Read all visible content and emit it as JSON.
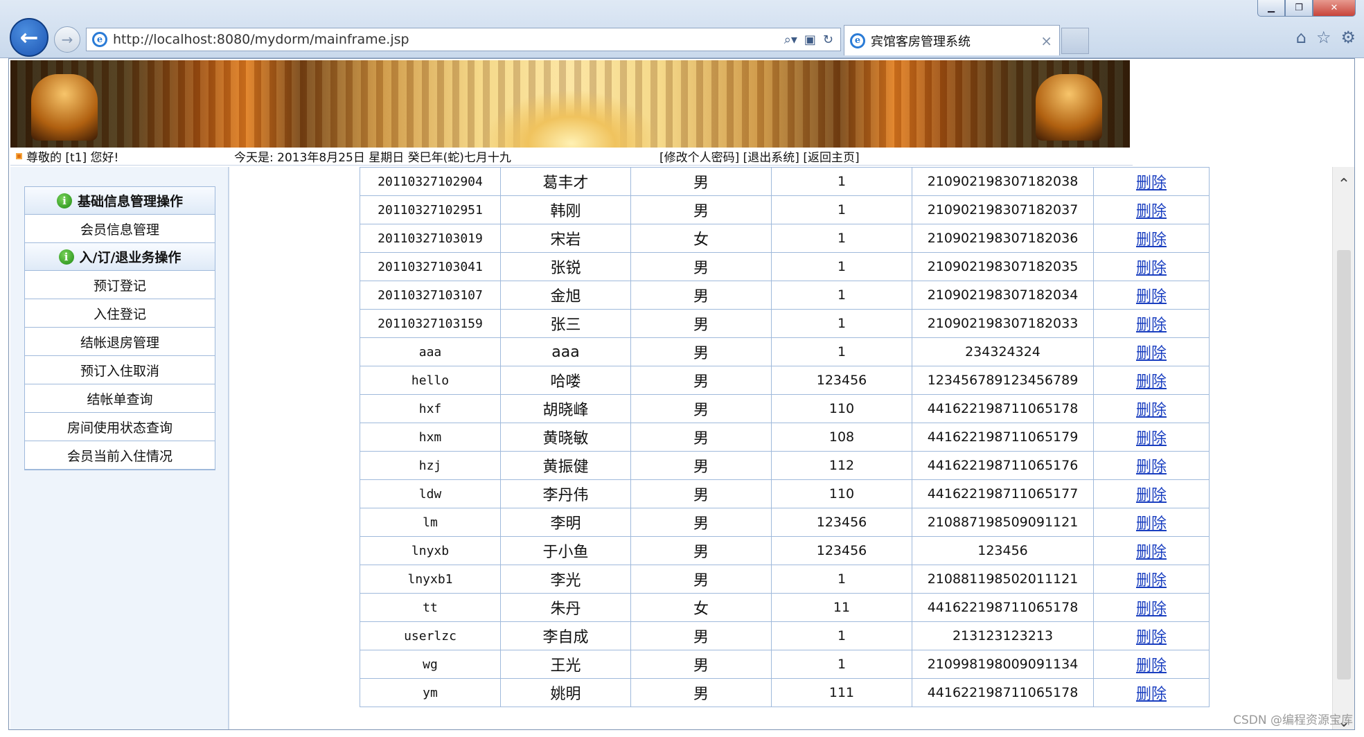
{
  "browser": {
    "url": "http://localhost:8080/mydorm/mainframe.jsp",
    "tab_title": "宾馆客房管理系统",
    "tab_close": "×"
  },
  "greeting": {
    "welcome": "尊敬的 [t1] 您好!",
    "date": "今天是:  2013年8月25日  星期日  癸巳年(蛇)七月十九",
    "links": "[修改个人密码] [退出系统] [返回主页]"
  },
  "sidebar": {
    "section1": "基础信息管理操作",
    "section1_items": [
      "会员信息管理"
    ],
    "section2": "入/订/退业务操作",
    "section2_items": [
      "预订登记",
      "入住登记",
      "结帐退房管理",
      "预订入住取消",
      "结帐单查询",
      "房间使用状态查询",
      "会员当前入住情况"
    ]
  },
  "table": {
    "delete_label": "删除",
    "rows": [
      [
        "20110327102904",
        "葛丰才",
        "男",
        "1",
        "210902198307182038"
      ],
      [
        "20110327102951",
        "韩刚",
        "男",
        "1",
        "210902198307182037"
      ],
      [
        "20110327103019",
        "宋岩",
        "女",
        "1",
        "210902198307182036"
      ],
      [
        "20110327103041",
        "张锐",
        "男",
        "1",
        "210902198307182035"
      ],
      [
        "20110327103107",
        "金旭",
        "男",
        "1",
        "210902198307182034"
      ],
      [
        "20110327103159",
        "张三",
        "男",
        "1",
        "210902198307182033"
      ],
      [
        "aaa",
        "aaa",
        "男",
        "1",
        "234324324"
      ],
      [
        "hello",
        "哈喽",
        "男",
        "123456",
        "123456789123456789"
      ],
      [
        "hxf",
        "胡晓峰",
        "男",
        "110",
        "441622198711065178"
      ],
      [
        "hxm",
        "黄晓敏",
        "男",
        "108",
        "441622198711065179"
      ],
      [
        "hzj",
        "黄振健",
        "男",
        "112",
        "441622198711065176"
      ],
      [
        "ldw",
        "李丹伟",
        "男",
        "110",
        "441622198711065177"
      ],
      [
        "lm",
        "李明",
        "男",
        "123456",
        "210887198509091121"
      ],
      [
        "lnyxb",
        "于小鱼",
        "男",
        "123456",
        "123456"
      ],
      [
        "lnyxb1",
        "李光",
        "男",
        "1",
        "210881198502011121"
      ],
      [
        "tt",
        "朱丹",
        "女",
        "11",
        "441622198711065178"
      ],
      [
        "userlzc",
        "李自成",
        "男",
        "1",
        "213123123213"
      ],
      [
        "wg",
        "王光",
        "男",
        "1",
        "210998198009091134"
      ],
      [
        "ym",
        "姚明",
        "男",
        "111",
        "441622198711065178"
      ]
    ]
  },
  "watermark": "CSDN @编程资源宝库"
}
